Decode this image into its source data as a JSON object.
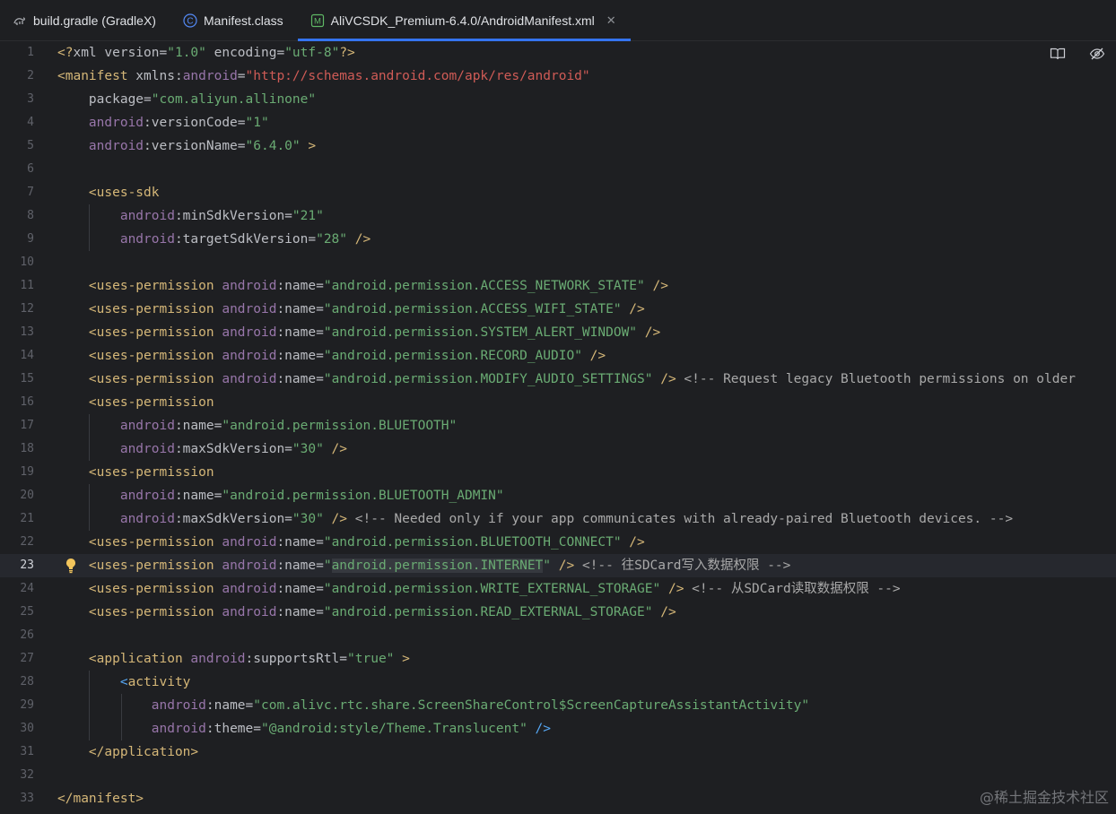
{
  "tabs": [
    {
      "label": "build.gradle (GradleX)",
      "icon": "gradle-icon",
      "active": false
    },
    {
      "label": "Manifest.class",
      "icon": "class-icon",
      "active": false
    },
    {
      "label": "AliVCSDK_Premium-6.4.0/AndroidManifest.xml",
      "icon": "manifest-icon",
      "active": true
    }
  ],
  "editor_icons": [
    "reader-mode-icon",
    "hide-icon"
  ],
  "current_line": 23,
  "watermark": "@稀土掘金技术社区",
  "lines": [
    [
      [
        "t-tag",
        "<?"
      ],
      [
        "t-attr",
        "xml version"
      ],
      [
        "t-attr",
        "="
      ],
      [
        "t-val",
        "\"1.0\""
      ],
      [
        "t-attr",
        " encoding"
      ],
      [
        "t-attr",
        "="
      ],
      [
        "t-val",
        "\"utf-8\""
      ],
      [
        "t-tag",
        "?>"
      ]
    ],
    [
      [
        "t-tag",
        "<manifest"
      ],
      [
        "t-attr",
        " xmlns:"
      ],
      [
        "t-ns",
        "android"
      ],
      [
        "t-attr",
        "="
      ],
      [
        "t-url",
        "\"http://schemas.android.com/apk/res/android\""
      ]
    ],
    [
      [
        "t-attr",
        "    package"
      ],
      [
        "t-attr",
        "="
      ],
      [
        "t-val",
        "\"com.aliyun.allinone\""
      ]
    ],
    [
      [
        "t-ns",
        "    android"
      ],
      [
        "t-attr",
        ":versionCode"
      ],
      [
        "t-attr",
        "="
      ],
      [
        "t-val",
        "\"1\""
      ]
    ],
    [
      [
        "t-ns",
        "    android"
      ],
      [
        "t-attr",
        ":versionName"
      ],
      [
        "t-attr",
        "="
      ],
      [
        "t-val",
        "\"6.4.0\""
      ],
      [
        "t-tag",
        " >"
      ]
    ],
    [],
    [
      [
        "t-tag",
        "    <uses-sdk"
      ]
    ],
    [
      [
        "t-ns",
        "        android"
      ],
      [
        "t-attr",
        ":minSdkVersion"
      ],
      [
        "t-attr",
        "="
      ],
      [
        "t-val",
        "\"21\""
      ]
    ],
    [
      [
        "t-ns",
        "        android"
      ],
      [
        "t-attr",
        ":targetSdkVersion"
      ],
      [
        "t-attr",
        "="
      ],
      [
        "t-val",
        "\"28\""
      ],
      [
        "t-tag",
        " />"
      ]
    ],
    [],
    [
      [
        "t-tag",
        "    <uses-permission"
      ],
      [
        "t-ns",
        " android"
      ],
      [
        "t-attr",
        ":name"
      ],
      [
        "t-attr",
        "="
      ],
      [
        "t-val",
        "\"android.permission.ACCESS_NETWORK_STATE\""
      ],
      [
        "t-tag",
        " />"
      ]
    ],
    [
      [
        "t-tag",
        "    <uses-permission"
      ],
      [
        "t-ns",
        " android"
      ],
      [
        "t-attr",
        ":name"
      ],
      [
        "t-attr",
        "="
      ],
      [
        "t-val",
        "\"android.permission.ACCESS_WIFI_STATE\""
      ],
      [
        "t-tag",
        " />"
      ]
    ],
    [
      [
        "t-tag",
        "    <uses-permission"
      ],
      [
        "t-ns",
        " android"
      ],
      [
        "t-attr",
        ":name"
      ],
      [
        "t-attr",
        "="
      ],
      [
        "t-val",
        "\"android.permission.SYSTEM_ALERT_WINDOW\""
      ],
      [
        "t-tag",
        " />"
      ]
    ],
    [
      [
        "t-tag",
        "    <uses-permission"
      ],
      [
        "t-ns",
        " android"
      ],
      [
        "t-attr",
        ":name"
      ],
      [
        "t-attr",
        "="
      ],
      [
        "t-val",
        "\"android.permission.RECORD_AUDIO\""
      ],
      [
        "t-tag",
        " />"
      ]
    ],
    [
      [
        "t-tag",
        "    <uses-permission"
      ],
      [
        "t-ns",
        " android"
      ],
      [
        "t-attr",
        ":name"
      ],
      [
        "t-attr",
        "="
      ],
      [
        "t-val",
        "\"android.permission.MODIFY_AUDIO_SETTINGS\""
      ],
      [
        "t-tag",
        " />"
      ],
      [
        "t-comment",
        " <!-- Request legacy Bluetooth permissions on older"
      ]
    ],
    [
      [
        "t-tag",
        "    <uses-permission"
      ]
    ],
    [
      [
        "t-ns",
        "        android"
      ],
      [
        "t-attr",
        ":name"
      ],
      [
        "t-attr",
        "="
      ],
      [
        "t-val",
        "\"android.permission.BLUETOOTH\""
      ]
    ],
    [
      [
        "t-ns",
        "        android"
      ],
      [
        "t-attr",
        ":maxSdkVersion"
      ],
      [
        "t-attr",
        "="
      ],
      [
        "t-val",
        "\"30\""
      ],
      [
        "t-tag",
        " />"
      ]
    ],
    [
      [
        "t-tag",
        "    <uses-permission"
      ]
    ],
    [
      [
        "t-ns",
        "        android"
      ],
      [
        "t-attr",
        ":name"
      ],
      [
        "t-attr",
        "="
      ],
      [
        "t-val",
        "\"android.permission.BLUETOOTH_ADMIN\""
      ]
    ],
    [
      [
        "t-ns",
        "        android"
      ],
      [
        "t-attr",
        ":maxSdkVersion"
      ],
      [
        "t-attr",
        "="
      ],
      [
        "t-val",
        "\"30\""
      ],
      [
        "t-tag",
        " />"
      ],
      [
        "t-comment",
        " <!-- Needed only if your app communicates with already-paired Bluetooth devices. -->"
      ]
    ],
    [
      [
        "t-tag",
        "    <uses-permission"
      ],
      [
        "t-ns",
        " android"
      ],
      [
        "t-attr",
        ":name"
      ],
      [
        "t-attr",
        "="
      ],
      [
        "t-val",
        "\"android.permission.BLUETOOTH_CONNECT\""
      ],
      [
        "t-tag",
        " />"
      ]
    ],
    [
      [
        "t-tag",
        "    <uses-permission"
      ],
      [
        "t-ns",
        " android"
      ],
      [
        "t-attr",
        ":name"
      ],
      [
        "t-attr",
        "="
      ],
      [
        "t-val",
        "\""
      ],
      [
        "t-val hl-val",
        "android.permission.INTERNET"
      ],
      [
        "t-val",
        "\""
      ],
      [
        "t-tag",
        " />"
      ],
      [
        "t-comment",
        " <!-- 往SDCard写入数据权限 -->"
      ]
    ],
    [
      [
        "t-tag",
        "    <uses-permission"
      ],
      [
        "t-ns",
        " android"
      ],
      [
        "t-attr",
        ":name"
      ],
      [
        "t-attr",
        "="
      ],
      [
        "t-val",
        "\"android.permission.WRITE_EXTERNAL_STORAGE\""
      ],
      [
        "t-tag",
        " />"
      ],
      [
        "t-comment",
        " <!-- 从SDCard读取数据权限 -->"
      ]
    ],
    [
      [
        "t-tag",
        "    <uses-permission"
      ],
      [
        "t-ns",
        " android"
      ],
      [
        "t-attr",
        ":name"
      ],
      [
        "t-attr",
        "="
      ],
      [
        "t-val",
        "\"android.permission.READ_EXTERNAL_STORAGE\""
      ],
      [
        "t-tag",
        " />"
      ]
    ],
    [],
    [
      [
        "t-tag",
        "    <application"
      ],
      [
        "t-ns",
        " android"
      ],
      [
        "t-attr",
        ":supportsRtl"
      ],
      [
        "t-attr",
        "="
      ],
      [
        "t-val",
        "\"true\""
      ],
      [
        "t-tag",
        " >"
      ]
    ],
    [
      [
        "t-bracket",
        "        <"
      ],
      [
        "t-tag",
        "activity"
      ]
    ],
    [
      [
        "t-ns",
        "            android"
      ],
      [
        "t-attr",
        ":name"
      ],
      [
        "t-attr",
        "="
      ],
      [
        "t-val",
        "\"com.alivc.rtc.share.ScreenShareControl$ScreenCaptureAssistantActivity\""
      ]
    ],
    [
      [
        "t-ns",
        "            android"
      ],
      [
        "t-attr",
        ":theme"
      ],
      [
        "t-attr",
        "="
      ],
      [
        "t-val",
        "\"@android:style/Theme.Translucent\""
      ],
      [
        "t-bracket",
        " />"
      ]
    ],
    [
      [
        "t-tag",
        "    </application>"
      ]
    ],
    [],
    [
      [
        "t-tag",
        "</manifest>"
      ]
    ]
  ]
}
